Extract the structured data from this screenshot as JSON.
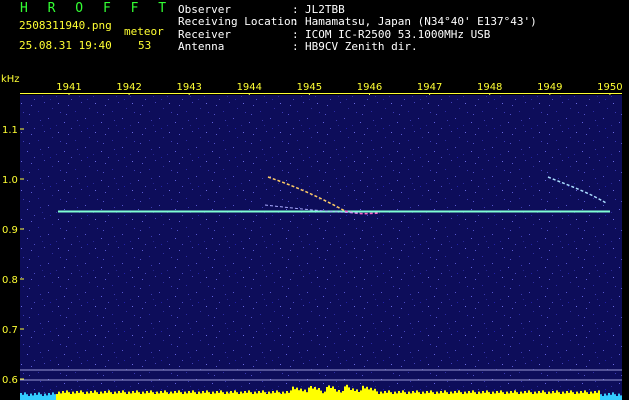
{
  "app_title": "H R O F F T",
  "file_name": "2508311940.png",
  "file_datetime": "25.08.31 19:40",
  "meteor_label": "meteor",
  "meteor_count": "53",
  "info": [
    {
      "key": "Observer",
      "value": "JL2TBB"
    },
    {
      "key": "Receiving Location",
      "value": "Hamamatsu, Japan (N34°40' E137°43')"
    },
    {
      "key": "Receiver",
      "value": "ICOM IC-R2500 53.1000MHz USB"
    },
    {
      "key": "Antenna",
      "value": "HB9CV Zenith dir."
    }
  ],
  "chart_data": {
    "type": "heatmap",
    "ylabel": "kHz",
    "y_ticks": [
      "1.1",
      "1.0",
      "0.9",
      "0.8",
      "0.7",
      "0.6"
    ],
    "y_values": [
      1.1,
      1.0,
      0.9,
      0.8,
      0.7,
      0.6
    ],
    "x_ticks": [
      "1941",
      "1942",
      "1943",
      "1944",
      "1945",
      "1946",
      "1947",
      "1948",
      "1949",
      "1950"
    ],
    "carrier_khz": 0.935,
    "colors": {
      "background": "#0d0d5a",
      "tick_label": "#ffff33",
      "carrier": "#7fffd4",
      "baseline_yellow": "#ffff00",
      "baseline_cyan": "#33ccff"
    }
  }
}
